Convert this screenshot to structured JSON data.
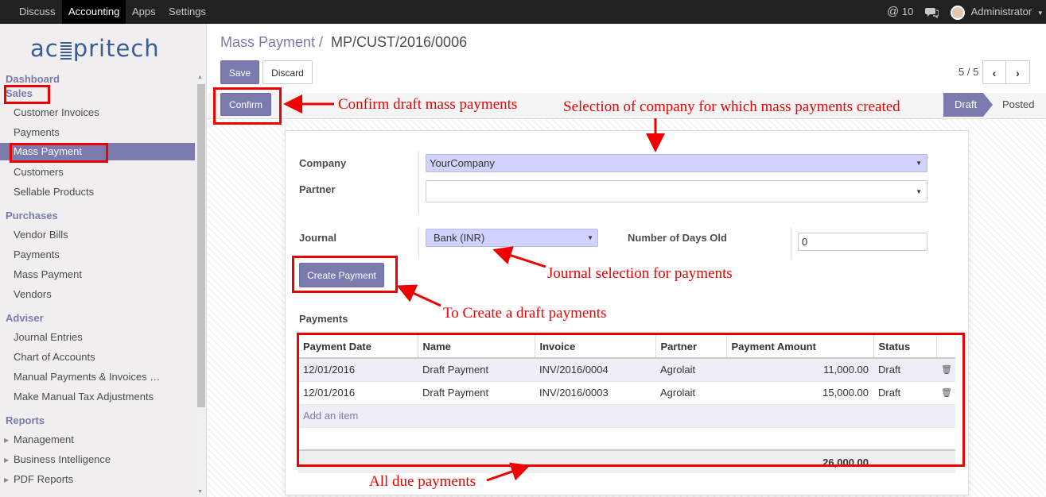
{
  "topbar": {
    "nav": [
      "Discuss",
      "Accounting",
      "Apps",
      "Settings"
    ],
    "mentions": "10",
    "user": "Administrator"
  },
  "sidebar": {
    "logo": "acsspritech",
    "dashboard": "Dashboard",
    "sales": "Sales",
    "sales_items": [
      "Customer Invoices",
      "Payments",
      "Mass Payment",
      "Customers",
      "Sellable Products"
    ],
    "purchases": "Purchases",
    "purchases_items": [
      "Vendor Bills",
      "Payments",
      "Mass Payment",
      "Vendors"
    ],
    "adviser": "Adviser",
    "adviser_items": [
      "Journal Entries",
      "Chart of Accounts",
      "Manual Payments & Invoices …",
      "Make Manual Tax Adjustments"
    ],
    "reports": "Reports",
    "reports_items": [
      "Management",
      "Business Intelligence",
      "PDF Reports"
    ]
  },
  "breadcrumb": {
    "parent": "Mass Payment /",
    "current": "MP/CUST/2016/0006"
  },
  "buttons": {
    "save": "Save",
    "discard": "Discard",
    "confirm": "Confirm",
    "create_payment": "Create Payment"
  },
  "pager": "5 / 5",
  "status": {
    "draft": "Draft",
    "posted": "Posted"
  },
  "form": {
    "company_label": "Company",
    "company_value": "YourCompany",
    "partner_label": "Partner",
    "partner_value": "",
    "journal_label": "Journal",
    "journal_value": "Bank (INR)",
    "days_label": "Number of Days Old",
    "days_value": "0",
    "payments_label": "Payments"
  },
  "table": {
    "headers": [
      "Payment Date",
      "Name",
      "Invoice",
      "Partner",
      "Payment Amount",
      "Status"
    ],
    "rows": [
      {
        "date": "12/01/2016",
        "name": "Draft Payment",
        "invoice": "INV/2016/0004",
        "partner": "Agrolait",
        "amount": "11,000.00",
        "status": "Draft"
      },
      {
        "date": "12/01/2016",
        "name": "Draft Payment",
        "invoice": "INV/2016/0003",
        "partner": "Agrolait",
        "amount": "15,000.00",
        "status": "Draft"
      }
    ],
    "add_item": "Add an item",
    "total": "26,000.00"
  },
  "annotations": {
    "confirm": "Confirm draft mass payments",
    "company": "Selection of company for which mass payments created",
    "journal": "Journal selection for payments",
    "create": "To Create a draft payments",
    "due": "All due payments"
  },
  "colors": {
    "accent": "#7c7bad",
    "annotation": "#e00000",
    "topbar": "#212121"
  }
}
